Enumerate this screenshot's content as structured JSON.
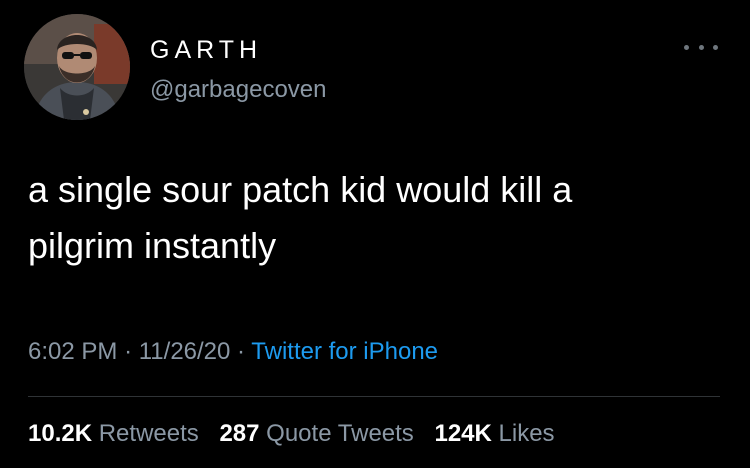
{
  "user": {
    "display_name": "GARTH",
    "handle": "@garbagecoven"
  },
  "tweet": {
    "text_line1": "a single sour patch kid would kill a",
    "text_line2": "pilgrim instantly",
    "time": "6:02 PM",
    "date": "11/26/20",
    "separator": "·",
    "source": "Twitter for iPhone"
  },
  "stats": {
    "retweets_count": "10.2K",
    "retweets_label": "Retweets",
    "quote_count": "287",
    "quote_label": "Quote Tweets",
    "likes_count": "124K",
    "likes_label": "Likes"
  },
  "icons": {
    "more": "more-options-icon",
    "avatar": "profile-photo"
  },
  "colors": {
    "background": "#000000",
    "primary_text": "#ffffff",
    "secondary_text": "#8b98a5",
    "link": "#1d9bf0"
  }
}
